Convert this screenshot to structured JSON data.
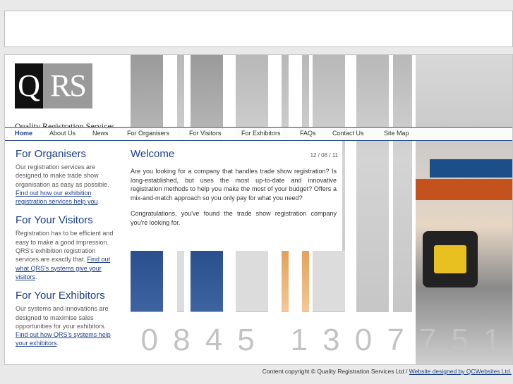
{
  "logo": {
    "mark_q": "Q",
    "mark_rs": "RS",
    "tagline": "Quality Registration Services"
  },
  "nav": {
    "items": [
      {
        "label": "Home"
      },
      {
        "label": "About Us"
      },
      {
        "label": "News"
      },
      {
        "label": "For Organisers"
      },
      {
        "label": "For Visitors"
      },
      {
        "label": "For Exhibitors"
      },
      {
        "label": "FAQs"
      },
      {
        "label": "Contact Us"
      },
      {
        "label": "Site Map"
      }
    ]
  },
  "sidebar": {
    "organisers": {
      "heading": "For Organisers",
      "text": "Our registration services are designed to make trade show organisation as easy as possible. ",
      "link": "Find out how our exhibition registration services help you",
      "after": "."
    },
    "visitors": {
      "heading": "For Your Visitors",
      "text": "Registration has to be efficient and easy to make a good impression. QRS's exhibition registration services are exactly that. ",
      "link": "Find out what QRS's systems give your visitors",
      "after": "."
    },
    "exhibitors": {
      "heading": "For Your Exhibitors",
      "text": "Our systems and innovations are designed to maximise sales opportunities for your exhibitors. ",
      "link": "Find out how QRS's systems help your exhibitors",
      "after": "."
    }
  },
  "welcome": {
    "title": "Welcome",
    "date": "12 / 06 / 11",
    "p1": "Are you looking for a company that handles trade show registration? Is long-established, but uses the most up-to-date and innovative registration methods to help you make the most of your budget? Offers a mix-and-match approach so you only pay for what you need?",
    "p2": "Congratulations, you've found the trade show registration company you're looking for."
  },
  "phone": {
    "digits": [
      "0",
      "8",
      "4",
      "5",
      "1",
      "3",
      "0",
      "7",
      "7",
      "5",
      "1"
    ]
  },
  "footer": {
    "copyright": "Content copyright © Quality Registration Services Ltd / ",
    "link": "Website designed by QCWebsites Ltd."
  }
}
